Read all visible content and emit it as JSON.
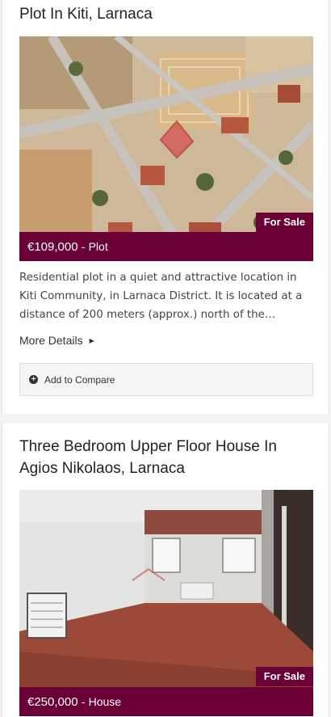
{
  "listings": [
    {
      "title": "Plot In Kiti, Larnaca",
      "status": "For Sale",
      "price": "€109,000",
      "separator": "-",
      "property_type": "Plot",
      "description": "Residential plot in a quiet and attractive location in Kiti Community, in Larnaca District. It is located at a distance of 200 meters (approx.) north of the…",
      "more_details": "More Details",
      "add_to_compare": "Add to Compare"
    },
    {
      "title": "Three Bedroom Upper Floor House In Agios Nikolaos, Larnaca",
      "status": "For Sale",
      "price": "€250,000",
      "separator": "-",
      "property_type": "House"
    }
  ],
  "colors": {
    "brand": "#6a0036",
    "compare_bg": "#f5f5f5"
  },
  "icons": {
    "more_details": "caret-right-icon",
    "compare": "plus-circle-icon"
  }
}
